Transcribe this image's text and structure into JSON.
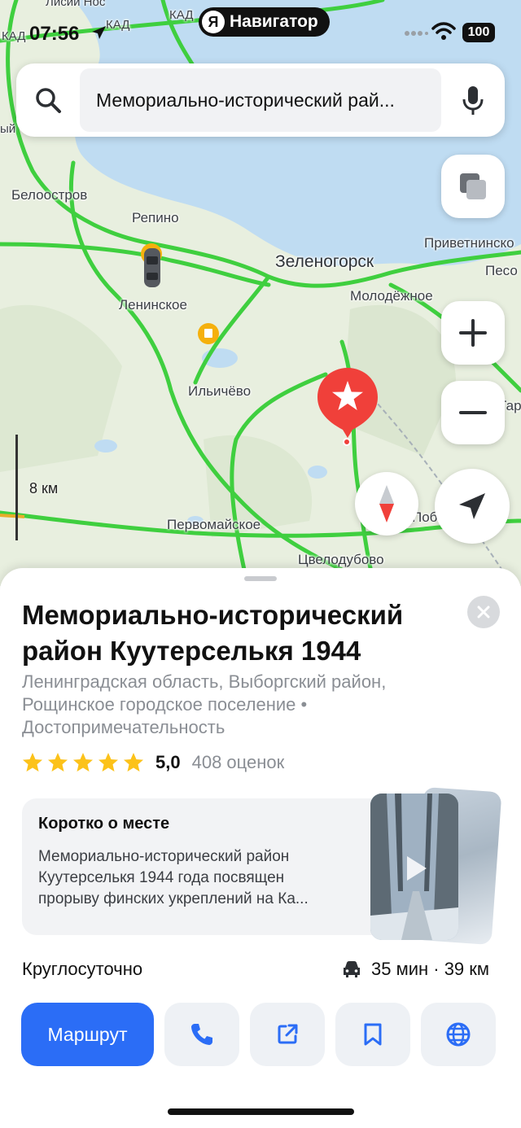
{
  "status_bar": {
    "time": "07:56",
    "app_pill_logo": "Я",
    "app_pill_label": "Навигатор",
    "battery": "100"
  },
  "search": {
    "value": "Мемориально-исторический рай..."
  },
  "map": {
    "labels": {
      "lisiy_nos": "Лисий Нос",
      "kad1": "КАД",
      "kad2": "КАД",
      "kad3": "КАД",
      "partial_left": "ый",
      "beloostrov": "Белоостров",
      "repino": "Репино",
      "privetninskoe": "Приветнинско",
      "zelenogorsk": "Зеленогорск",
      "pesochnoe": "Песо",
      "leninskoe": "Ленинское",
      "molodezhnoe": "Молодёжное",
      "ilichyovo": "Ильичёво",
      "tarasovo": "Тарасо",
      "pervomayskoe": "Первомайское",
      "pobeda": "Победа",
      "tsvelodubovo": "Цвелодубово"
    },
    "scale_label": "8 км"
  },
  "place": {
    "title": "Мемориально-исторический район Куутерселькя 1944",
    "address": "Ленинградская область, Выборгский район, Рощинское городское поселение • Достопримечательность",
    "rating_value": "5,0",
    "rating_stars": 5,
    "rating_count": "408 оценок",
    "about_title": "Коротко о месте",
    "about_text": "Мемориально-исторический район Куутерселькя 1944 года посвящен прорыву финских укреплений на Ка...",
    "hours": "Круглосуточно",
    "travel": "35 мин · 39 км",
    "route_label": "Маршрут"
  },
  "colors": {
    "accent": "#2b6df6",
    "pin": "#f0403a",
    "road": "#3fcf3f",
    "water": "#bfdcf2",
    "land": "#e8efdf",
    "star": "#fcc21a"
  },
  "icons": [
    "search-icon",
    "mic-icon",
    "layers-icon",
    "plus-icon",
    "minus-icon",
    "compass-icon",
    "location-arrow-icon",
    "star-pin-icon",
    "close-icon",
    "car-icon",
    "phone-icon",
    "share-icon",
    "bookmark-icon",
    "globe-icon",
    "play-icon"
  ]
}
